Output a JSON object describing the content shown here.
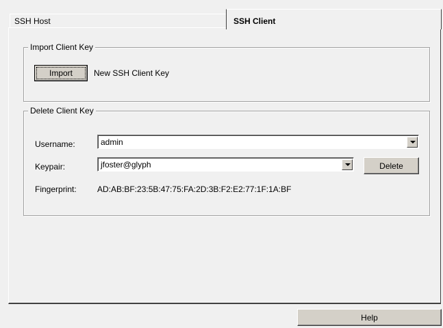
{
  "tabs": [
    {
      "label": "SSH Host"
    },
    {
      "label": "SSH Client"
    }
  ],
  "import_group": {
    "title": "Import Client Key",
    "import_button": "Import",
    "description": "New SSH Client Key"
  },
  "delete_group": {
    "title": "Delete Client Key",
    "username_label": "Username:",
    "username_value": "admin",
    "keypair_label": "Keypair:",
    "keypair_value": "jfoster@glyph",
    "delete_button": "Delete",
    "fingerprint_label": "Fingerprint:",
    "fingerprint_value": "AD:AB:BF:23:5B:47:75:FA:2D:3B:F2:E2:77:1F:1A:BF"
  },
  "footer": {
    "help_button": "Help"
  },
  "colors": {
    "window_bg": "#f0f0f0",
    "button_face": "#d4d0c8"
  }
}
